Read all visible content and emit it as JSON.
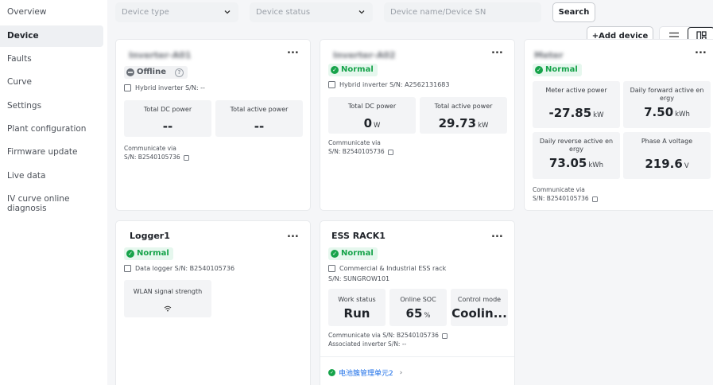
{
  "sidebar": {
    "items": [
      {
        "label": "Overview"
      },
      {
        "label": "Device"
      },
      {
        "label": "Faults"
      },
      {
        "label": "Curve"
      },
      {
        "label": "Settings"
      },
      {
        "label": "Plant configuration"
      },
      {
        "label": "Firmware update"
      },
      {
        "label": "Live data"
      },
      {
        "label": "IV curve online\ndiagnosis"
      }
    ],
    "active_index": 1
  },
  "filters": {
    "device_type_placeholder": "Device type",
    "device_status_placeholder": "Device status",
    "search_placeholder": "Device name/Device SN",
    "search_button": "Search",
    "add_device_button": "+Add device"
  },
  "cards": {
    "c1": {
      "title": "Inverter-A01",
      "menu": "...",
      "status": "Offline",
      "info": "Hybrid inverter S/N: --",
      "metrics": [
        {
          "label": "Total DC power",
          "value": "--",
          "unit": ""
        },
        {
          "label": "Total active power",
          "value": "--",
          "unit": ""
        }
      ],
      "comm_label": "Communicate via",
      "comm_sn": "S/N: B2540105736"
    },
    "c2": {
      "title": "Inverter-A02",
      "menu": "...",
      "status": "Normal",
      "info": "Hybrid inverter S/N: A2562131683",
      "metrics": [
        {
          "label": "Total DC power",
          "value": "0",
          "unit": "W"
        },
        {
          "label": "Total active power",
          "value": "29.73",
          "unit": "kW"
        }
      ],
      "comm_label": "Communicate via",
      "comm_sn": "S/N: B2540105736"
    },
    "c3": {
      "title": "Meter",
      "menu": "...",
      "status": "Normal",
      "metrics": [
        {
          "label": "Meter active power",
          "value": "-27.85",
          "unit": "kW"
        },
        {
          "label": "Daily forward active en ergy",
          "value": "7.50",
          "unit": "kWh"
        },
        {
          "label": "Daily reverse active en ergy",
          "value": "73.05",
          "unit": "kWh"
        },
        {
          "label": "Phase A voltage",
          "value": "219.6",
          "unit": "V"
        }
      ],
      "comm_label": "Communicate via",
      "comm_sn": "S/N: B2540105736"
    },
    "c4": {
      "title": "Logger1",
      "menu": "...",
      "status": "Normal",
      "info": "Data logger S/N: B2540105736",
      "metric_label": "WLAN signal strength"
    },
    "c5": {
      "title": "ESS RACK1",
      "menu": "...",
      "status": "Normal",
      "info": "Commercial & Industrial ESS rack",
      "info_sn": "S/N: SUNGROW101",
      "metrics": [
        {
          "label": "Work status",
          "value": "Run",
          "unit": ""
        },
        {
          "label": "Online SOC",
          "value": "65",
          "unit": "%"
        },
        {
          "label": "Control mode",
          "value": "Coolin...",
          "unit": ""
        }
      ],
      "comm_line": "Communicate via  S/N: B2540105736",
      "assoc_line": "Associated inverter  S/N: --",
      "sub_link": "电池簇管理单元2"
    }
  }
}
